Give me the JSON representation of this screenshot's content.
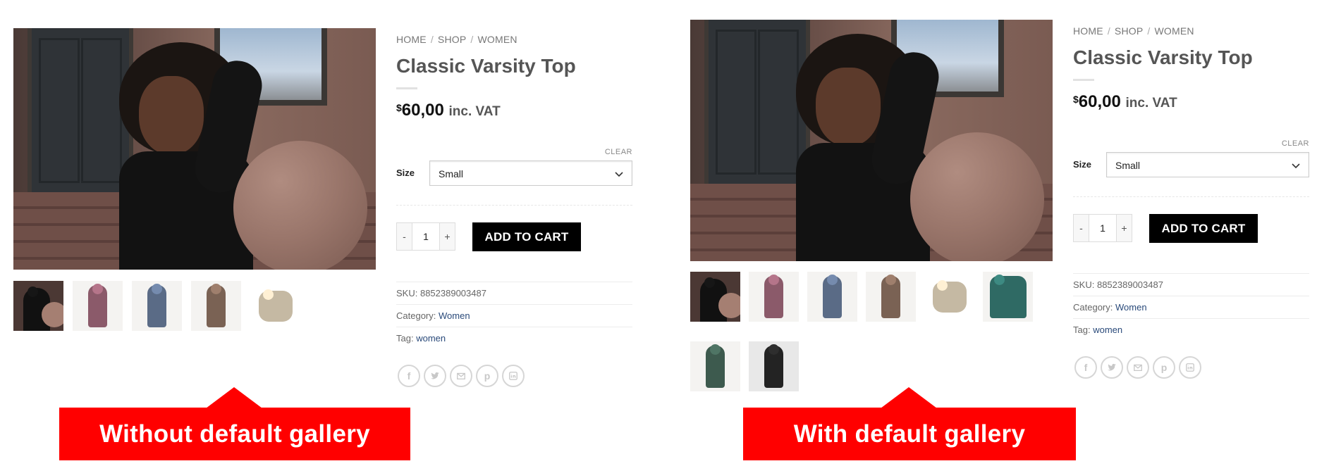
{
  "product": {
    "breadcrumb": [
      "HOME",
      "SHOP",
      "WOMEN"
    ],
    "title": "Classic Varsity Top",
    "price_currency": "$",
    "price_amount": "60,00",
    "price_suffix": "inc. VAT",
    "size_label": "Size",
    "size_value": "Small",
    "clear_label": "CLEAR",
    "qty_minus": "-",
    "qty_value": "1",
    "qty_plus": "+",
    "add_to_cart": "ADD TO CART",
    "sku_label": "SKU:",
    "sku": "8852389003487",
    "category_label": "Category:",
    "category": "Women",
    "tag_label": "Tag:",
    "tag": "women"
  },
  "share_icons": [
    "facebook-icon",
    "twitter-icon",
    "email-icon",
    "pinterest-icon",
    "linkedin-icon"
  ],
  "left_variant": {
    "label": "Without default gallery",
    "thumbnails": [
      "woman-with-ball",
      "varsity-jacket-red",
      "varsity-jacket-blue",
      "varsity-jacket-brown",
      "varsity-bag"
    ]
  },
  "right_variant": {
    "label": "With default gallery",
    "thumbnails": [
      "woman-with-ball",
      "varsity-jacket-red",
      "varsity-jacket-blue",
      "varsity-jacket-brown",
      "varsity-bag",
      "varsity-jacket-green",
      "varsity-jacket-cream",
      "varsity-jacket-black"
    ]
  },
  "colors": {
    "callout_red": "#ff0000",
    "button_black": "#000000"
  }
}
